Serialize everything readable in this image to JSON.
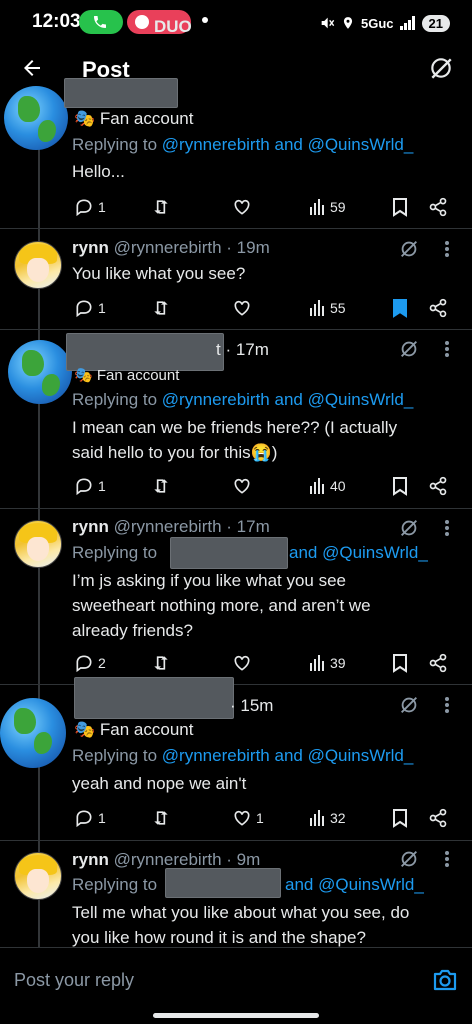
{
  "status_bar": {
    "time": "12:03",
    "app_pill": "DUO",
    "network": "5Guc",
    "battery": "21"
  },
  "header": {
    "title": "Post"
  },
  "posts": [
    {
      "badge": "Fan account",
      "replying_prefix": "Replying to",
      "replying_to": "@rynnerebirth and @QuinsWrld_",
      "text": "Hello...",
      "metrics": {
        "replies": "1",
        "likes": "",
        "views": "59"
      }
    },
    {
      "name": "rynn",
      "handle": "@rynnerebirth",
      "time": "· 19m",
      "text": "You like what you see?",
      "metrics": {
        "replies": "1",
        "likes": "",
        "views": "55"
      }
    },
    {
      "time": "t · 17m",
      "badge": "Fan account",
      "replying_prefix": "Replying to",
      "replying_to": "@rynnerebirth and @QuinsWrld_",
      "text_lines": [
        "I mean can we be friends here?? (I actually",
        "said hello to you for this😭)"
      ],
      "metrics": {
        "replies": "1",
        "likes": "",
        "views": "40"
      }
    },
    {
      "name": "rynn",
      "handle": "@rynnerebirth",
      "time": "· 17m",
      "replying_prefix": "Replying to",
      "replying_to": "and @QuinsWrld_",
      "text_lines": [
        "I’m js asking if you like what you see",
        "sweetheart nothing more, and aren’t we",
        "already friends?"
      ],
      "metrics": {
        "replies": "2",
        "likes": "",
        "views": "39"
      }
    },
    {
      "time": "· 15m",
      "badge": "Fan account",
      "replying_prefix": "Replying to",
      "replying_to": "@rynnerebirth and @QuinsWrld_",
      "text": "yeah and nope we ain't",
      "metrics": {
        "replies": "1",
        "likes": "1",
        "views": "32"
      }
    },
    {
      "name": "rynn",
      "handle": "@rynnerebirth",
      "time": "· 9m",
      "replying_prefix": "Replying to",
      "replying_to": "and @QuinsWrld_",
      "text_lines": [
        "Tell me what you like about what you see, do",
        "you like how round it is and the shape?"
      ]
    }
  ],
  "reply_bar": {
    "placeholder": "Post your reply"
  },
  "colors": {
    "accent": "#1d9bf0",
    "muted": "#8b98a5",
    "background": "#000000"
  }
}
